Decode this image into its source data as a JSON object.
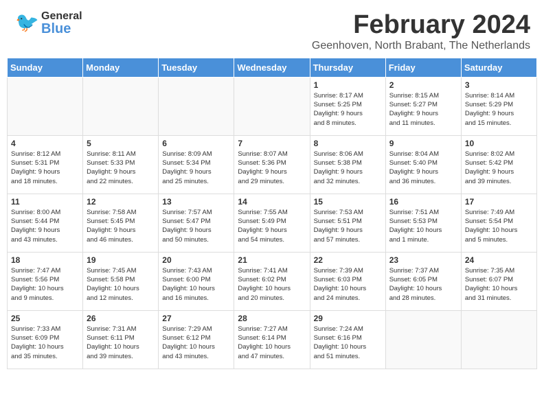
{
  "header": {
    "logo_general": "General",
    "logo_blue": "Blue",
    "month_year": "February 2024",
    "location": "Geenhoven, North Brabant, The Netherlands"
  },
  "weekdays": [
    "Sunday",
    "Monday",
    "Tuesday",
    "Wednesday",
    "Thursday",
    "Friday",
    "Saturday"
  ],
  "weeks": [
    [
      {
        "day": "",
        "info": ""
      },
      {
        "day": "",
        "info": ""
      },
      {
        "day": "",
        "info": ""
      },
      {
        "day": "",
        "info": ""
      },
      {
        "day": "1",
        "info": "Sunrise: 8:17 AM\nSunset: 5:25 PM\nDaylight: 9 hours\nand 8 minutes."
      },
      {
        "day": "2",
        "info": "Sunrise: 8:15 AM\nSunset: 5:27 PM\nDaylight: 9 hours\nand 11 minutes."
      },
      {
        "day": "3",
        "info": "Sunrise: 8:14 AM\nSunset: 5:29 PM\nDaylight: 9 hours\nand 15 minutes."
      }
    ],
    [
      {
        "day": "4",
        "info": "Sunrise: 8:12 AM\nSunset: 5:31 PM\nDaylight: 9 hours\nand 18 minutes."
      },
      {
        "day": "5",
        "info": "Sunrise: 8:11 AM\nSunset: 5:33 PM\nDaylight: 9 hours\nand 22 minutes."
      },
      {
        "day": "6",
        "info": "Sunrise: 8:09 AM\nSunset: 5:34 PM\nDaylight: 9 hours\nand 25 minutes."
      },
      {
        "day": "7",
        "info": "Sunrise: 8:07 AM\nSunset: 5:36 PM\nDaylight: 9 hours\nand 29 minutes."
      },
      {
        "day": "8",
        "info": "Sunrise: 8:06 AM\nSunset: 5:38 PM\nDaylight: 9 hours\nand 32 minutes."
      },
      {
        "day": "9",
        "info": "Sunrise: 8:04 AM\nSunset: 5:40 PM\nDaylight: 9 hours\nand 36 minutes."
      },
      {
        "day": "10",
        "info": "Sunrise: 8:02 AM\nSunset: 5:42 PM\nDaylight: 9 hours\nand 39 minutes."
      }
    ],
    [
      {
        "day": "11",
        "info": "Sunrise: 8:00 AM\nSunset: 5:44 PM\nDaylight: 9 hours\nand 43 minutes."
      },
      {
        "day": "12",
        "info": "Sunrise: 7:58 AM\nSunset: 5:45 PM\nDaylight: 9 hours\nand 46 minutes."
      },
      {
        "day": "13",
        "info": "Sunrise: 7:57 AM\nSunset: 5:47 PM\nDaylight: 9 hours\nand 50 minutes."
      },
      {
        "day": "14",
        "info": "Sunrise: 7:55 AM\nSunset: 5:49 PM\nDaylight: 9 hours\nand 54 minutes."
      },
      {
        "day": "15",
        "info": "Sunrise: 7:53 AM\nSunset: 5:51 PM\nDaylight: 9 hours\nand 57 minutes."
      },
      {
        "day": "16",
        "info": "Sunrise: 7:51 AM\nSunset: 5:53 PM\nDaylight: 10 hours\nand 1 minute."
      },
      {
        "day": "17",
        "info": "Sunrise: 7:49 AM\nSunset: 5:54 PM\nDaylight: 10 hours\nand 5 minutes."
      }
    ],
    [
      {
        "day": "18",
        "info": "Sunrise: 7:47 AM\nSunset: 5:56 PM\nDaylight: 10 hours\nand 9 minutes."
      },
      {
        "day": "19",
        "info": "Sunrise: 7:45 AM\nSunset: 5:58 PM\nDaylight: 10 hours\nand 12 minutes."
      },
      {
        "day": "20",
        "info": "Sunrise: 7:43 AM\nSunset: 6:00 PM\nDaylight: 10 hours\nand 16 minutes."
      },
      {
        "day": "21",
        "info": "Sunrise: 7:41 AM\nSunset: 6:02 PM\nDaylight: 10 hours\nand 20 minutes."
      },
      {
        "day": "22",
        "info": "Sunrise: 7:39 AM\nSunset: 6:03 PM\nDaylight: 10 hours\nand 24 minutes."
      },
      {
        "day": "23",
        "info": "Sunrise: 7:37 AM\nSunset: 6:05 PM\nDaylight: 10 hours\nand 28 minutes."
      },
      {
        "day": "24",
        "info": "Sunrise: 7:35 AM\nSunset: 6:07 PM\nDaylight: 10 hours\nand 31 minutes."
      }
    ],
    [
      {
        "day": "25",
        "info": "Sunrise: 7:33 AM\nSunset: 6:09 PM\nDaylight: 10 hours\nand 35 minutes."
      },
      {
        "day": "26",
        "info": "Sunrise: 7:31 AM\nSunset: 6:11 PM\nDaylight: 10 hours\nand 39 minutes."
      },
      {
        "day": "27",
        "info": "Sunrise: 7:29 AM\nSunset: 6:12 PM\nDaylight: 10 hours\nand 43 minutes."
      },
      {
        "day": "28",
        "info": "Sunrise: 7:27 AM\nSunset: 6:14 PM\nDaylight: 10 hours\nand 47 minutes."
      },
      {
        "day": "29",
        "info": "Sunrise: 7:24 AM\nSunset: 6:16 PM\nDaylight: 10 hours\nand 51 minutes."
      },
      {
        "day": "",
        "info": ""
      },
      {
        "day": "",
        "info": ""
      }
    ]
  ]
}
